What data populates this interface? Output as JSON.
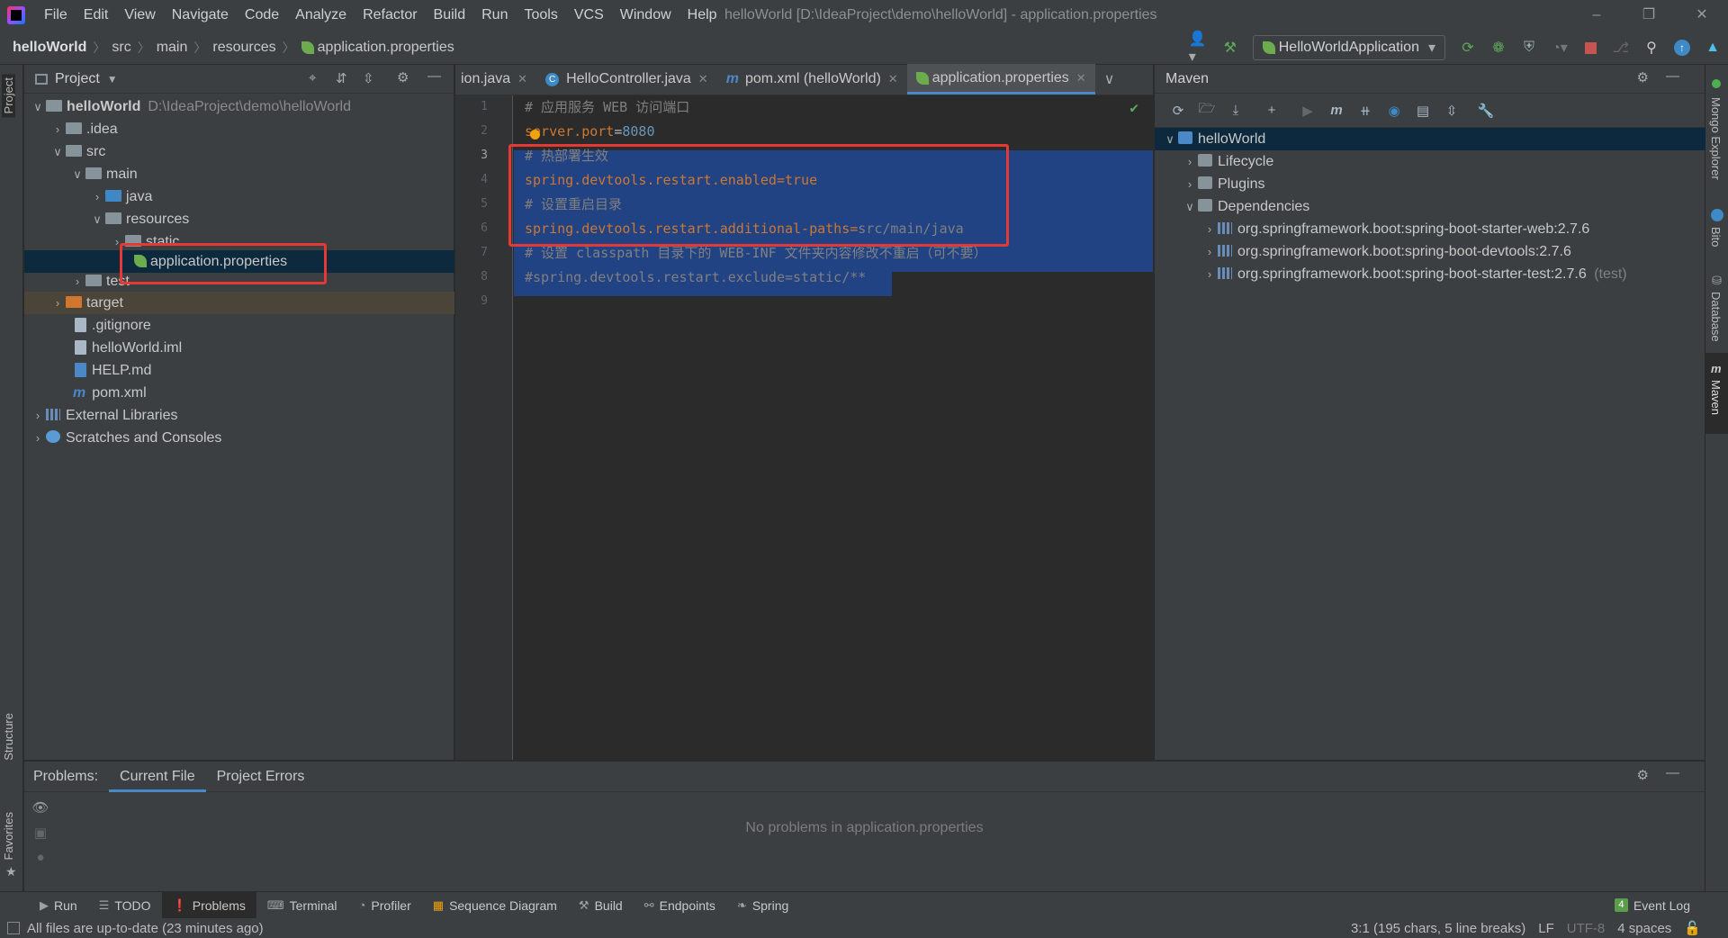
{
  "app": {
    "window_title": "helloWorld [D:\\IdeaProject\\demo\\helloWorld] - application.properties"
  },
  "menu": [
    "File",
    "Edit",
    "View",
    "Navigate",
    "Code",
    "Analyze",
    "Refactor",
    "Build",
    "Run",
    "Tools",
    "VCS",
    "Window",
    "Help"
  ],
  "breadcrumb": [
    "helloWorld",
    "src",
    "main",
    "resources",
    "application.properties"
  ],
  "run_config": "HelloWorldApplication",
  "project": {
    "title": "Project",
    "tree": [
      {
        "label": "helloWorld",
        "path": "D:\\IdeaProject\\demo\\helloWorld"
      },
      {
        "label": ".idea"
      },
      {
        "label": "src"
      },
      {
        "label": "main"
      },
      {
        "label": "java"
      },
      {
        "label": "resources"
      },
      {
        "label": "static"
      },
      {
        "label": "application.properties"
      },
      {
        "label": "test"
      },
      {
        "label": "target"
      },
      {
        "label": ".gitignore"
      },
      {
        "label": "helloWorld.iml"
      },
      {
        "label": "HELP.md"
      },
      {
        "label": "pom.xml"
      },
      {
        "label": "External Libraries"
      },
      {
        "label": "Scratches and Consoles"
      }
    ]
  },
  "editor": {
    "tabs": [
      "ion.java",
      "HelloController.java",
      "pom.xml (helloWorld)",
      "application.properties"
    ],
    "line_numbers": [
      "1",
      "2",
      "3",
      "4",
      "5",
      "6",
      "7",
      "8",
      "9"
    ],
    "lines": [
      {
        "kind": "comment",
        "text": "# 应用服务 WEB 访问端口"
      },
      {
        "kind": "kv",
        "key": "server.port",
        "value": "8080"
      },
      {
        "kind": "comment",
        "text": "# 热部署生效"
      },
      {
        "kind": "kv",
        "key": "spring.devtools.restart.enabled",
        "value": "true"
      },
      {
        "kind": "comment",
        "text": "# 设置重启目录"
      },
      {
        "kind": "kv",
        "key": "spring.devtools.restart.additional-paths",
        "value": "src/main/java"
      },
      {
        "kind": "comment",
        "text": "# 设置 classpath 目录下的 WEB-INF 文件夹内容修改不重启（可不要）"
      },
      {
        "kind": "comment",
        "text": "#spring.devtools.restart.exclude=static/**"
      },
      {
        "kind": "blank",
        "text": ""
      }
    ]
  },
  "maven": {
    "title": "Maven",
    "tree": [
      {
        "label": "helloWorld"
      },
      {
        "label": "Lifecycle"
      },
      {
        "label": "Plugins"
      },
      {
        "label": "Dependencies"
      },
      {
        "label": "org.springframework.boot:spring-boot-starter-web:2.7.6"
      },
      {
        "label": "org.springframework.boot:spring-boot-devtools:2.7.6"
      },
      {
        "label": "org.springframework.boot:spring-boot-starter-test:2.7.6",
        "suffix": "(test)"
      }
    ]
  },
  "problems": {
    "label": "Problems:",
    "tabs": [
      "Current File",
      "Project Errors"
    ],
    "empty_text": "No problems in application.properties"
  },
  "left_strip": [
    "Project",
    "Structure",
    "Favorites"
  ],
  "right_strip": [
    "Mongo Explorer",
    "Bito",
    "Database",
    "Maven"
  ],
  "bottom_tabs": [
    "Run",
    "TODO",
    "Problems",
    "Terminal",
    "Profiler",
    "Sequence Diagram",
    "Build",
    "Endpoints",
    "Spring"
  ],
  "event_log": {
    "count": "4",
    "label": "Event Log"
  },
  "status": {
    "message": "All files are up-to-date (23 minutes ago)",
    "position": "3:1 (195 chars, 5 line breaks)",
    "line_sep": "LF",
    "encoding": "UTF-8",
    "indent": "4 spaces"
  }
}
